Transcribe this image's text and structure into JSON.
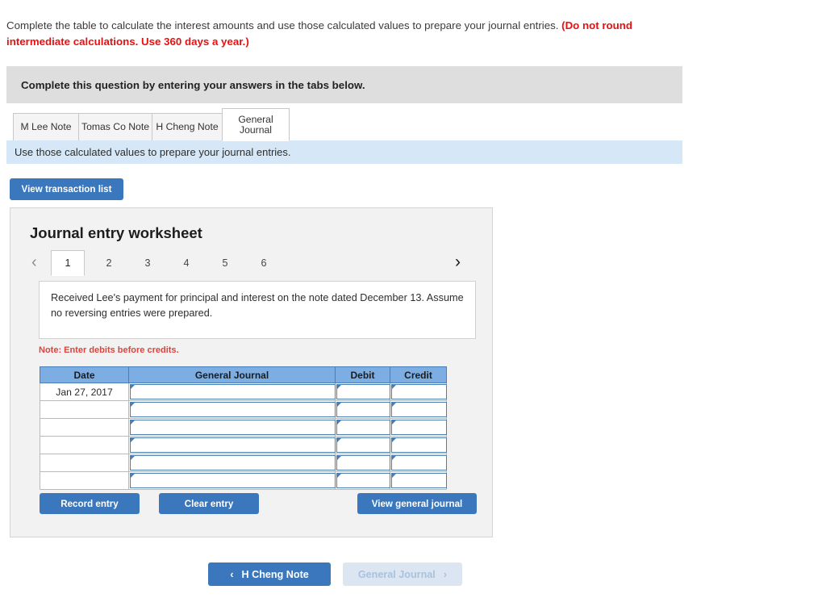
{
  "prompt": {
    "main": "Complete the table to calculate the interest amounts and use those calculated values to prepare your journal entries. ",
    "emphasis": "(Do not round intermediate calculations. Use 360 days a year.)"
  },
  "instruction_bar": {
    "text": "Complete this question by entering your answers in the tabs below."
  },
  "tabs": [
    {
      "label": "M Lee Note",
      "active": false
    },
    {
      "label": "Tomas Co Note",
      "active": false
    },
    {
      "label": "H Cheng Note",
      "active": false
    },
    {
      "label": "General Journal",
      "active": true
    }
  ],
  "sub_instruction": {
    "text": "Use those calculated values to prepare your journal entries."
  },
  "toolbar": {
    "view_transaction_list": "View transaction list"
  },
  "worksheet": {
    "title": "Journal entry worksheet",
    "pager": {
      "prev_icon": "‹",
      "next_icon": "›",
      "pages": [
        "1",
        "2",
        "3",
        "4",
        "5",
        "6"
      ],
      "active_page": "1"
    },
    "transaction": {
      "text": "Received Lee's payment for principal and interest on the note dated December 13. Assume no reversing entries were prepared."
    },
    "note": "Note: Enter debits before credits.",
    "table": {
      "headers": [
        "Date",
        "General Journal",
        "Debit",
        "Credit"
      ],
      "rows": [
        {
          "date": "Jan 27, 2017",
          "general_journal": "",
          "debit": "",
          "credit": ""
        },
        {
          "date": "",
          "general_journal": "",
          "debit": "",
          "credit": ""
        },
        {
          "date": "",
          "general_journal": "",
          "debit": "",
          "credit": ""
        },
        {
          "date": "",
          "general_journal": "",
          "debit": "",
          "credit": ""
        },
        {
          "date": "",
          "general_journal": "",
          "debit": "",
          "credit": ""
        },
        {
          "date": "",
          "general_journal": "",
          "debit": "",
          "credit": ""
        }
      ]
    },
    "actions": {
      "record_entry": "Record entry",
      "clear_entry": "Clear entry",
      "view_general_journal": "View general journal"
    }
  },
  "bottom_nav": {
    "prev_label": "H Cheng Note",
    "prev_icon": "‹",
    "next_label": "General Journal",
    "next_icon": "›",
    "next_disabled": true
  },
  "colors": {
    "primary_blue": "#3a77bd",
    "disabled_blue": "#dbe6f2",
    "table_header_blue": "#7cade3",
    "field_border_blue": "#4a7fb5",
    "instruction_grey": "#dedede",
    "sub_instruction_blue": "#d6e8f7",
    "panel_grey": "#f2f2f2",
    "emphasis_red": "#e8110f",
    "note_red": "#d9453c"
  }
}
